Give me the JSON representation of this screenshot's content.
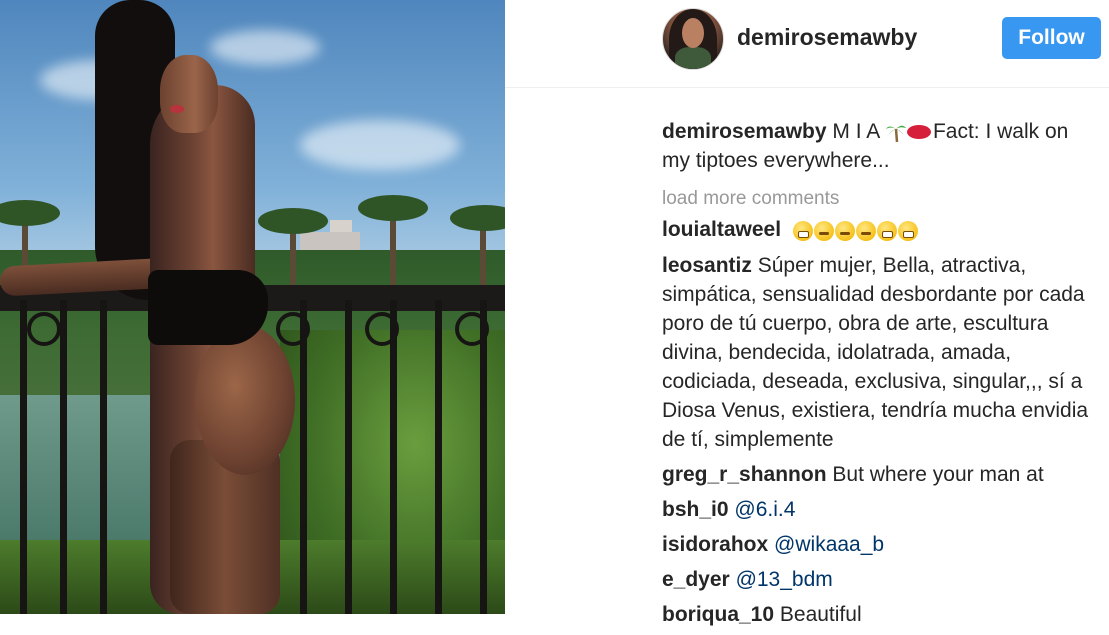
{
  "post": {
    "username": "demirosemawby",
    "follow_label": "Follow"
  },
  "caption": {
    "user": "demirosemawby",
    "text_before": "M I A",
    "emoji_1": "palm-tree-emoji",
    "emoji_2": "kiss-lips-emoji",
    "text_after": "Fact: I walk on my tiptoes everywhere..."
  },
  "load_more": "load more comments",
  "comments": [
    {
      "user": "louialtaweel",
      "text": "",
      "emoji": [
        "grinning-face-emoji",
        "neutral-face-emoji",
        "neutral-face-emoji",
        "neutral-face-emoji",
        "grinning-face-emoji",
        "grinning-face-emoji"
      ]
    },
    {
      "user": "leosantiz",
      "text": "Súper mujer, Bella, atractiva, simpática, sensualidad desbordante por cada poro de tú cuerpo, obra de arte, escultura divina, bendecida, idolatrada, amada, codiciada, deseada, exclusiva, singular,,, sí a Diosa Venus, existiera, tendría mucha envidia de tí, simplemente"
    },
    {
      "user": "greg_r_shannon",
      "text": "But where your man at"
    },
    {
      "user": "bsh_i0",
      "mention": "@6.i.4"
    },
    {
      "user": "isidorahox",
      "mention": "@wikaaa_b"
    },
    {
      "user": "e_dyer",
      "mention": "@13_bdm"
    },
    {
      "user": "boriqua_10",
      "text": "Beautiful"
    }
  ],
  "colors": {
    "follow_button": "#3897f0",
    "mention": "#003569",
    "muted": "#999999"
  }
}
